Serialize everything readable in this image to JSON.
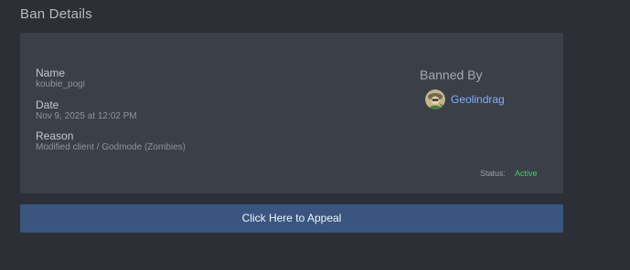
{
  "page": {
    "title": "Ban Details"
  },
  "ban": {
    "name_label": "Name",
    "name_value": "koubie_pogi",
    "date_label": "Date",
    "date_value": "Nov 9, 2025 at 12:02 PM",
    "reason_label": "Reason",
    "reason_value": "Modified client / Godmode (Zombies)"
  },
  "banned_by": {
    "heading": "Banned By",
    "moderator": "Geolindrag",
    "avatar_icon": "user-avatar-icon"
  },
  "status": {
    "label": "Status:",
    "value": "Active",
    "color": "#3fd06b"
  },
  "appeal": {
    "button_label": "Click Here to Appeal",
    "button_color": "#3a5680"
  }
}
